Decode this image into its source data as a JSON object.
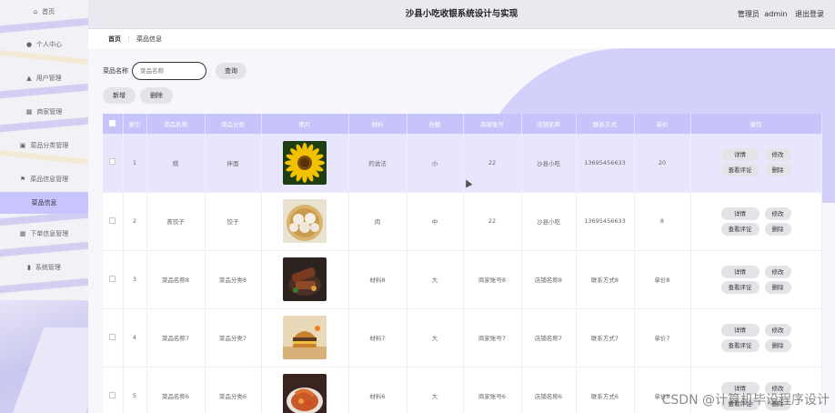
{
  "header": {
    "title": "沙县小吃收银系统设计与实现",
    "role": "管理员",
    "username": "admin",
    "logout": "退出登录"
  },
  "breadcrumb": {
    "home": "首页",
    "current": "菜品信息"
  },
  "sidebar": {
    "items": [
      {
        "label": "首页",
        "icon": "home-icon"
      },
      {
        "label": "个人中心",
        "icon": "user-icon"
      },
      {
        "label": "用户管理",
        "icon": "users-icon"
      },
      {
        "label": "商家管理",
        "icon": "grid-icon"
      },
      {
        "label": "菜品分类管理",
        "icon": "category-icon"
      },
      {
        "label": "菜品信息管理",
        "icon": "flag-icon"
      },
      {
        "label": "菜品信息",
        "icon": ""
      },
      {
        "label": "下单信息管理",
        "icon": "grid-icon"
      },
      {
        "label": "系统管理",
        "icon": "chart-icon"
      }
    ],
    "active_index": 6
  },
  "search": {
    "label": "菜品名称",
    "placeholder": "菜品名称",
    "button": "查询"
  },
  "actions": {
    "add": "新增",
    "delete": "删除"
  },
  "table": {
    "headers": [
      "",
      "索引",
      "菜品名称",
      "菜品分类",
      "图片",
      "材料",
      "份额",
      "商家账号",
      "店铺名称",
      "联系方式",
      "单价",
      "操作"
    ],
    "ops": {
      "detail": "详情",
      "edit": "修改",
      "comments": "查看评论",
      "delete": "删除"
    },
    "rows": [
      {
        "index": "1",
        "name": "棋",
        "category": "拌面",
        "image": "sunflower",
        "material": "的说法",
        "portion": "小",
        "account": "22",
        "shop": "沙县小吃",
        "contact": "13695456633",
        "price": "20"
      },
      {
        "index": "2",
        "name": "蒸饺子",
        "category": "饺子",
        "image": "dumplings",
        "material": "肉",
        "portion": "中",
        "account": "22",
        "shop": "沙县小吃",
        "contact": "13695456633",
        "price": "8"
      },
      {
        "index": "3",
        "name": "菜品名称8",
        "category": "菜品分类8",
        "image": "grilled-meat",
        "material": "材料8",
        "portion": "大",
        "account": "商家账号8",
        "shop": "店铺名称8",
        "contact": "联系方式8",
        "price": "单价8"
      },
      {
        "index": "4",
        "name": "菜品名称7",
        "category": "菜品分类7",
        "image": "burger",
        "material": "材料7",
        "portion": "大",
        "account": "商家账号7",
        "shop": "店铺名称7",
        "contact": "联系方式7",
        "price": "单价7"
      },
      {
        "index": "5",
        "name": "菜品名称6",
        "category": "菜品分类6",
        "image": "seafood",
        "material": "材料6",
        "portion": "大",
        "account": "商家账号6",
        "shop": "店铺名称6",
        "contact": "联系方式6",
        "price": "单价6"
      }
    ]
  },
  "watermark": "CSDN @计算机毕设程序设计",
  "colors": {
    "accent": "#c7c4fb",
    "highlight_row": "#e7e6fd",
    "active_menu": "#c7c4ff"
  }
}
